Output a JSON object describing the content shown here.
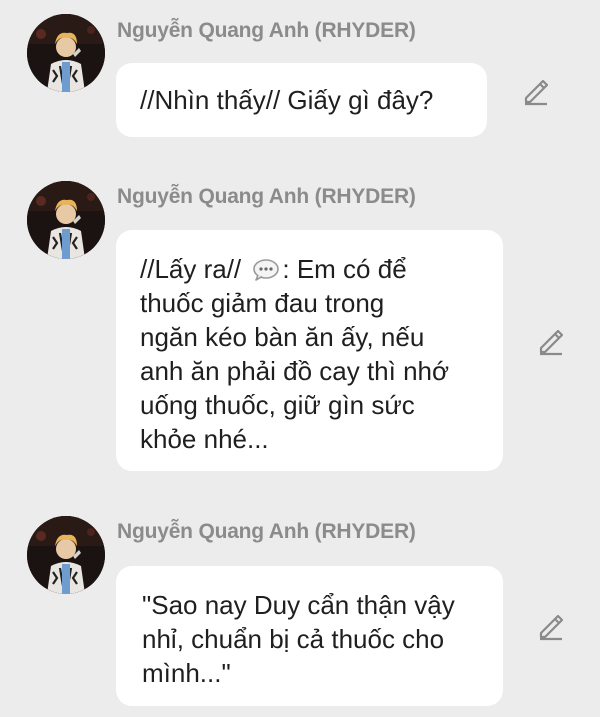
{
  "messages": [
    {
      "sender": "Nguyễn Quang Anh (RHYDER)",
      "text": "//Nhìn thấy// Giấy gì đây?"
    },
    {
      "sender": "Nguyễn Quang Anh (RHYDER)",
      "text_before_icon": "//Lấy ra// ",
      "icon": "speech-bubble-ellipsis-icon",
      "text_after_icon": ": Em có để\nthuốc giảm đau trong\nngăn kéo bàn ăn ấy, nếu\nanh ăn phải đồ cay thì nhớ\nuống thuốc, giữ gìn sức\nkhỏe nhé..."
    },
    {
      "sender": "Nguyễn Quang Anh (RHYDER)",
      "text": "\"Sao nay Duy cẩn thận vậy\nnhỉ, chuẩn bị cả thuốc cho\nmình...\""
    }
  ],
  "colors": {
    "background": "#ececec",
    "bubble": "#ffffff",
    "sender_name": "#8b8b8b",
    "message_text": "#1f1f1f",
    "edit_icon": "#8a8a8a"
  },
  "icons": {
    "avatar": "avatar-photo",
    "edit": "pencil-edit-icon"
  }
}
